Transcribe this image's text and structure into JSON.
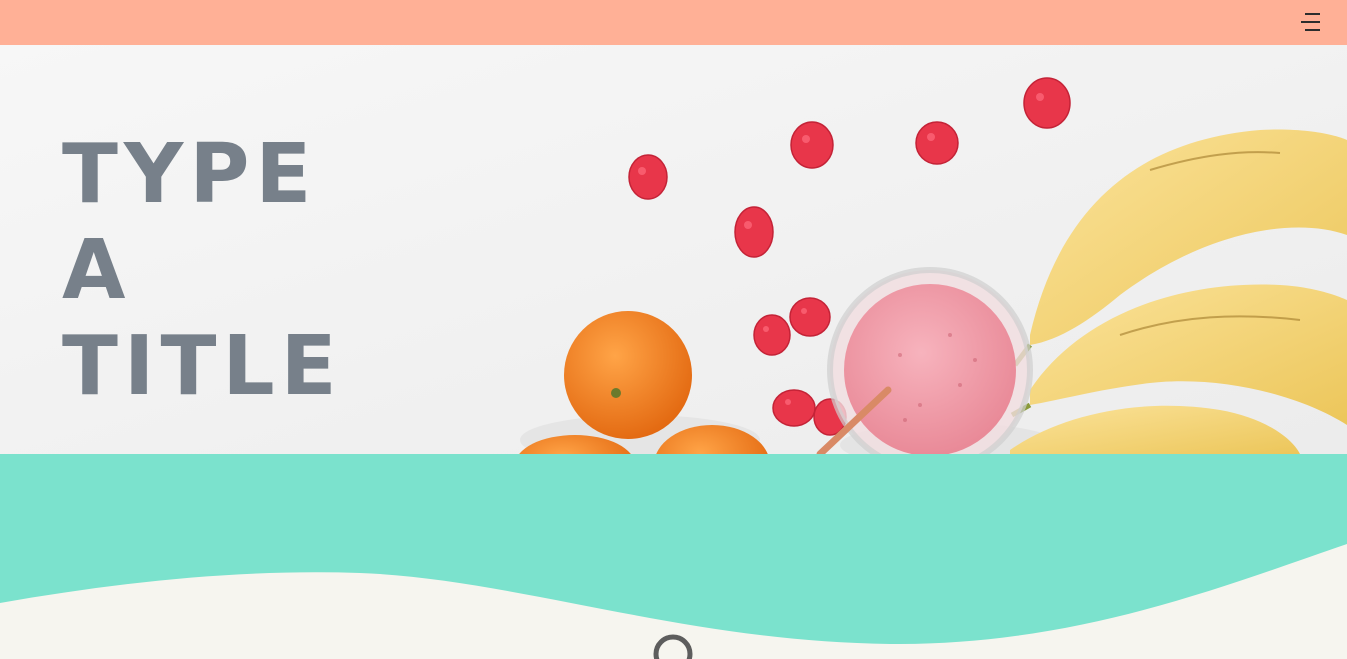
{
  "header": {
    "menu_icon": "menu-icon",
    "background": "#ffb096"
  },
  "hero": {
    "title_lines": [
      "TYPE",
      "A",
      "TITLE"
    ],
    "title_color": "#77808a",
    "image": "fruit-smoothie-photo"
  },
  "section": {
    "band_color": "#7be2cd",
    "wave_color": "#f6f5ef",
    "indicator_icon": "loading-ring-icon"
  }
}
